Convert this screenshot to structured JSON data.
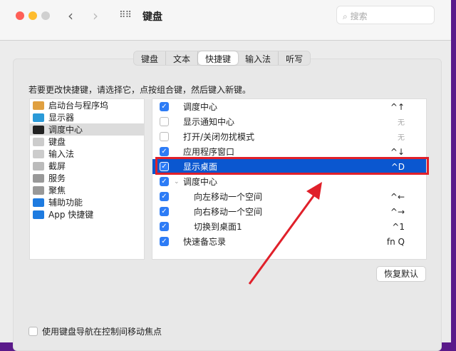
{
  "window": {
    "title": "键盘",
    "search_placeholder": "搜索"
  },
  "tabs": [
    "键盘",
    "文本",
    "快捷键",
    "输入法",
    "听写"
  ],
  "active_tab": 2,
  "instruction": "若要更改快捷键，请选择它，点按组合键，然后键入新键。",
  "categories": [
    {
      "label": "启动台与程序坞",
      "icon": "launchpad-icon",
      "color": "#e0a040"
    },
    {
      "label": "显示器",
      "icon": "display-icon",
      "color": "#2a9ad8"
    },
    {
      "label": "调度中心",
      "icon": "mission-control-icon",
      "color": "#222222"
    },
    {
      "label": "键盘",
      "icon": "keyboard-icon",
      "color": "#cccccc"
    },
    {
      "label": "输入法",
      "icon": "input-source-icon",
      "color": "#cccccc"
    },
    {
      "label": "截屏",
      "icon": "screenshot-icon",
      "color": "#bbbbbb"
    },
    {
      "label": "服务",
      "icon": "gear-icon",
      "color": "#999999"
    },
    {
      "label": "聚焦",
      "icon": "spotlight-icon",
      "color": "#999999"
    },
    {
      "label": "辅助功能",
      "icon": "accessibility-icon",
      "color": "#1e7be0"
    },
    {
      "label": "App 快捷键",
      "icon": "app-store-icon",
      "color": "#1e7be0"
    }
  ],
  "selected_category": 2,
  "shortcuts": [
    {
      "label": "调度中心",
      "checked": true,
      "key": "^↑",
      "indent": false
    },
    {
      "label": "显示通知中心",
      "checked": false,
      "key": "无",
      "indent": false
    },
    {
      "label": "打开/关闭勿扰模式",
      "checked": false,
      "key": "无",
      "indent": false
    },
    {
      "label": "应用程序窗口",
      "checked": true,
      "key": "^↓",
      "indent": false
    },
    {
      "label": "显示桌面",
      "checked": true,
      "key": "^D",
      "indent": false,
      "highlighted": true
    },
    {
      "label": "调度中心",
      "checked": true,
      "key": "",
      "indent": false,
      "group": true
    },
    {
      "label": "向左移动一个空间",
      "checked": true,
      "key": "^←",
      "indent": true
    },
    {
      "label": "向右移动一个空间",
      "checked": true,
      "key": "^→",
      "indent": true
    },
    {
      "label": "切换到桌面1",
      "checked": true,
      "key": "^1",
      "indent": true
    },
    {
      "label": "快速备忘录",
      "checked": true,
      "key": "fn Q",
      "indent": false
    }
  ],
  "restore_button": "恢复默认",
  "keyboard_nav": {
    "label": "使用键盘导航在控制间移动焦点",
    "checked": false
  }
}
